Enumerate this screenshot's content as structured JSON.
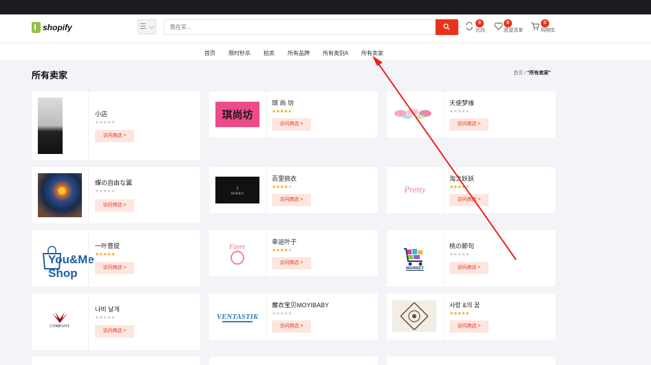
{
  "header": {
    "logo_text": "shopify",
    "category_button": "☰ ⌵",
    "search_placeholder": "我在买...",
    "compare": {
      "label": "比较",
      "count": "0"
    },
    "wishlist": {
      "label": "愿望清单",
      "count": "0"
    },
    "cart": {
      "label": "购物车",
      "count": "0"
    }
  },
  "nav": {
    "items": [
      "首页",
      "限时秒杀",
      "拍卖",
      "所有品牌",
      "所有类别A",
      "所有卖家"
    ]
  },
  "page": {
    "title": "所有卖家",
    "breadcrumb_home": "首页",
    "breadcrumb_sep": "/",
    "breadcrumb_current": "\"所有卖家\""
  },
  "sellers": [
    {
      "name": "小店",
      "stars": 0,
      "visit": "访问商店 >",
      "logo": "photo-woman"
    },
    {
      "name": "琪 尚 坊",
      "stars": 5,
      "visit": "访问商店 >",
      "logo": "琪尚坊"
    },
    {
      "name": "天使梦缘",
      "stars": 0,
      "visit": "访问商店 >",
      "logo": "macarons"
    },
    {
      "name": "蝶の自由な翼",
      "stars": 0,
      "visit": "访问商店 >",
      "logo": "butterfly"
    },
    {
      "name": "百里挑衣",
      "stars": 4.5,
      "visit": "访问商店 >",
      "logo": "RONICS"
    },
    {
      "name": "淘之妖妖",
      "stars": 4.5,
      "visit": "访问商店 >",
      "logo": "Pretty"
    },
    {
      "name": "一叶菩提",
      "stars": 5,
      "visit": "访问商店 >",
      "logo": "You&Me Shop"
    },
    {
      "name": "幸运叶子",
      "stars": 4.5,
      "visit": "访问商店 >",
      "logo": "Fayre"
    },
    {
      "name": "桃の節句",
      "stars": 0,
      "visit": "访问商店 >",
      "logo": "MARKET"
    },
    {
      "name": "나비 날개",
      "stars": 0,
      "visit": "访问商店 >",
      "logo": "COMPANY"
    },
    {
      "name": "魔衣宝贝MOYIBABY",
      "stars": 0,
      "visit": "访问商店 >",
      "logo": "VENTASTIK"
    },
    {
      "name": "사랑 &의 꿈",
      "stars": 5,
      "visit": "访问商店 >",
      "logo": "ornament"
    }
  ],
  "annotation": {
    "color": "#e8231a",
    "type": "arrow"
  },
  "colors": {
    "accent": "#e8331a",
    "star": "#f5a623",
    "visit_bg": "#fde6e0"
  }
}
